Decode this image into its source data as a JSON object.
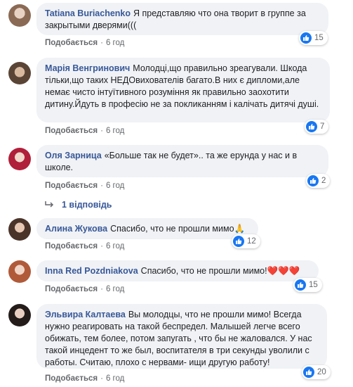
{
  "comments": [
    {
      "author": "Tatiana Buriachenko",
      "text": "Я представляю что она творит в группе за закрытыми дверями(((",
      "like": "Подобається",
      "time": "6 год",
      "reactions": "15",
      "avatar_icon": "user-avatar-photo"
    },
    {
      "author": "Марія Венгринович",
      "text": "Молодці,що правильно зреагували. Шкода тільки,що таких НЕДОвихователів багато.В них є дипломи,але немає чисто інтуїтивного розуміння як правильно заохотити дитину.Йдуть в професію не за покликанням і калічать дитячі душі.",
      "like": "Подобається",
      "time": "6 год",
      "reactions": "7",
      "avatar_icon": "user-avatar-photo"
    },
    {
      "author": "Оля Зарница",
      "text": "«Больше так не будет».. та же ерунда у нас и в школе.",
      "like": "Подобається",
      "time": "6 год",
      "reactions": "2",
      "avatar_icon": "user-avatar-photo"
    },
    {
      "author": "Алина Жукова",
      "text": "Спасибо, что не прошли мимо",
      "emoji": "🙏",
      "like": "Подобається",
      "time": "6 год",
      "reactions": "12",
      "avatar_icon": "user-avatar-photo"
    },
    {
      "author": "Inna Red Pozdniakova",
      "text": "Спасибо, что не прошли мимо!",
      "emoji": "❤️❤️❤️",
      "like": "Подобається",
      "time": "6 год",
      "reactions": "15",
      "avatar_icon": "user-avatar-photo"
    },
    {
      "author": "Эльвира Калтаева",
      "text": "Вы молодцы, что не прошли мимо! Всегда нужно реагировать на такой беспредел. Малышей легче всего обижать, тем более, потом запугать , что бы не жаловался. У нас такой инцедент то же был, воспитателя в три секунды уволили с работы. Считаю, плохо с нервами- ищи другую работу!",
      "like": "Подобається",
      "time": "6 год",
      "reactions": "20",
      "avatar_icon": "user-avatar-photo"
    }
  ],
  "replies_link": "1 відповідь",
  "colors": {
    "author": "#385898",
    "bubble": "#f0f2f5",
    "like_badge": "#1877f2",
    "meta": "#65676b"
  }
}
